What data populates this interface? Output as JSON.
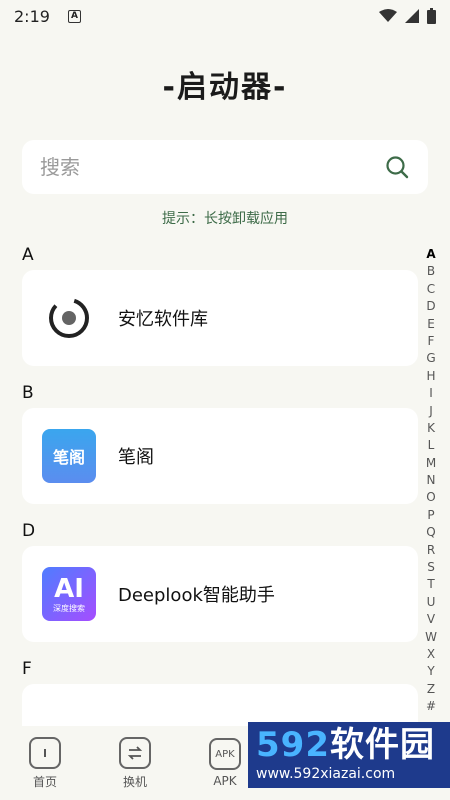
{
  "status": {
    "time": "2:19",
    "notif": "A"
  },
  "header": {
    "title": "-启动器-"
  },
  "search": {
    "placeholder": "搜索"
  },
  "hint": "提示：长按卸载应用",
  "sections": [
    {
      "letter": "A",
      "app": {
        "name": "安忆软件库",
        "icon": "ink-calligraphy-icon"
      }
    },
    {
      "letter": "B",
      "app": {
        "name": "笔阁",
        "icon": "bige-book-icon",
        "icon_text": "笔阁"
      }
    },
    {
      "letter": "D",
      "app": {
        "name": "Deeplook智能助手",
        "icon": "ai-search-icon",
        "icon_text": "AI",
        "icon_sub": "深度搜索"
      }
    },
    {
      "letter": "F"
    }
  ],
  "alphabet": [
    "A",
    "B",
    "C",
    "D",
    "E",
    "F",
    "G",
    "H",
    "I",
    "J",
    "K",
    "L",
    "M",
    "N",
    "O",
    "P",
    "Q",
    "R",
    "S",
    "T",
    "U",
    "V",
    "W",
    "X",
    "Y",
    "Z",
    "#"
  ],
  "nav": [
    {
      "label": "首页",
      "icon": "home-icon"
    },
    {
      "label": "换机",
      "icon": "swap-icon"
    },
    {
      "label": "APK",
      "icon": "apk-icon",
      "icon_text": "APK"
    }
  ],
  "watermark": {
    "num": "592",
    "text": "软件园",
    "url": "www.592xiazai.com"
  },
  "colors": {
    "background": "#f7f7f2",
    "hint": "#3d6b48",
    "search_icon": "#3d6b48"
  }
}
